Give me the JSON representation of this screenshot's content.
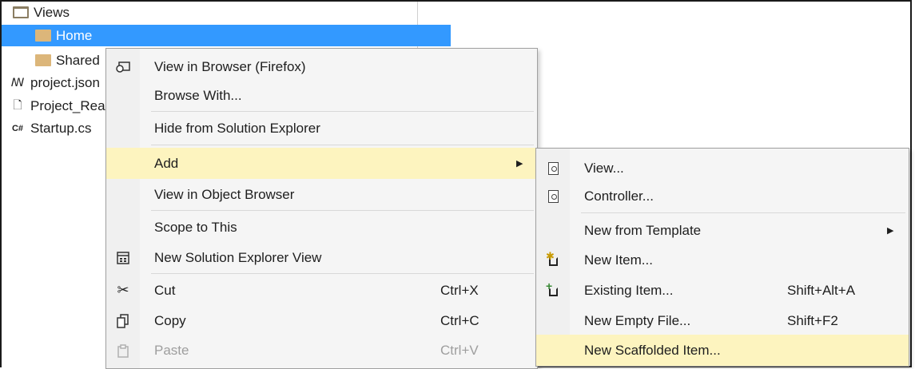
{
  "tree": {
    "items": [
      {
        "label": "Views"
      },
      {
        "label": "Home"
      },
      {
        "label": "Shared"
      },
      {
        "label": "project.json"
      },
      {
        "label": "Project_Readme.html"
      },
      {
        "label": "Startup.cs"
      }
    ],
    "csharp_badge": "C#"
  },
  "context_menu": {
    "items": [
      {
        "label": "View in Browser (Firefox)"
      },
      {
        "label": "Browse With..."
      },
      {
        "label": "Hide from Solution Explorer"
      },
      {
        "label": "Add"
      },
      {
        "label": "View in Object Browser"
      },
      {
        "label": "Scope to This"
      },
      {
        "label": "New Solution Explorer View"
      },
      {
        "label": "Cut",
        "shortcut": "Ctrl+X"
      },
      {
        "label": "Copy",
        "shortcut": "Ctrl+C"
      },
      {
        "label": "Paste",
        "shortcut": "Ctrl+V"
      }
    ]
  },
  "add_submenu": {
    "items": [
      {
        "label": "View..."
      },
      {
        "label": "Controller..."
      },
      {
        "label": "New from Template"
      },
      {
        "label": "New Item..."
      },
      {
        "label": "Existing Item...",
        "shortcut": "Shift+Alt+A"
      },
      {
        "label": "New Empty File...",
        "shortcut": "Shift+F2"
      },
      {
        "label": "New Scaffolded Item..."
      }
    ]
  },
  "colors": {
    "selection": "#3399ff",
    "menu_highlight": "#fdf4bf",
    "menu_background": "#f5f5f5",
    "folder": "#dcb67a"
  },
  "icons": {
    "expand_arrow": "▶",
    "view_in_browser": "browser-icon",
    "cut": "✂",
    "copy": "⧉",
    "paste": "📋"
  }
}
